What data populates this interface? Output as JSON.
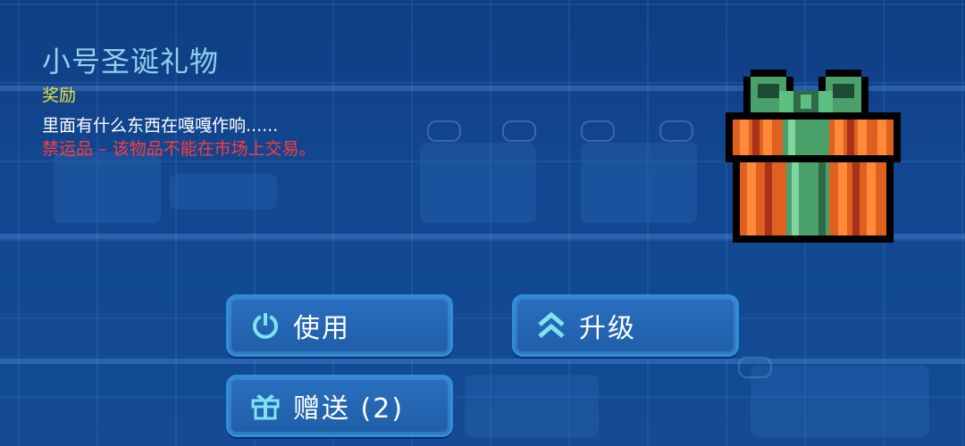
{
  "item": {
    "title": "小号圣诞礼物",
    "category": "奖励",
    "description": "里面有什么东西在嘎嘎作响......",
    "warning": "禁运品 – 该物品不能在市场上交易。",
    "icon": "gift-box-icon"
  },
  "actions": {
    "use_label": "使用",
    "upgrade_label": "升级",
    "gift_label": "赠送 (2)"
  },
  "colors": {
    "title": "#8fd0ec",
    "category": "#e8e23a",
    "description": "#ffffff",
    "warning": "#ff3b3b",
    "button_border": "#2f8fd6",
    "background": "#134a92"
  }
}
